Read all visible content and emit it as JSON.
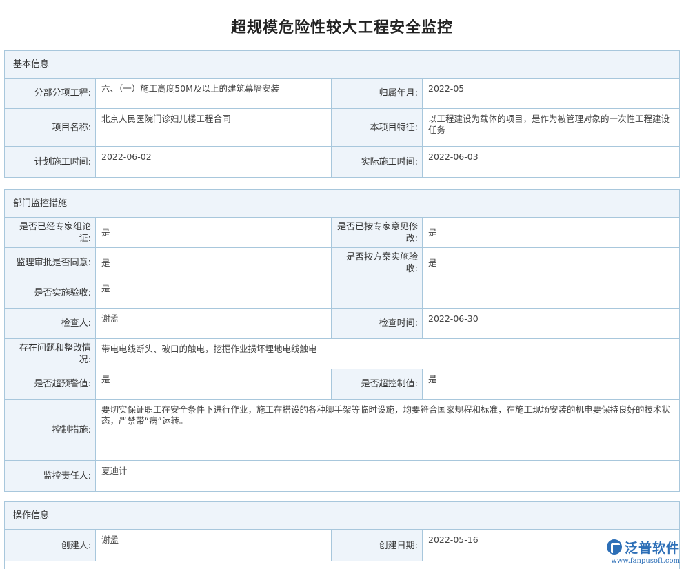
{
  "page": {
    "title": "超规模危险性较大工程安全监控"
  },
  "basic": {
    "header": "基本信息",
    "sub_project_label": "分部分项工程:",
    "sub_project_value": "六、（一）施工高度50M及以上的建筑幕墙安装",
    "month_label": "归属年月:",
    "month_value": "2022-05",
    "project_name_label": "项目名称:",
    "project_name_value": "北京人民医院门诊妇儿楼工程合同",
    "feature_label": "本项目特征:",
    "feature_value": "以工程建设为载体的项目，是作为被管理对象的一次性工程建设任务",
    "plan_date_label": "计划施工时间:",
    "plan_date_value": "2022-06-02",
    "actual_date_label": "实际施工时间:",
    "actual_date_value": "2022-06-03"
  },
  "monitor": {
    "header": "部门监控措施",
    "expert_label": "是否已经专家组论证:",
    "expert_value": "是",
    "revised_label": "是否已按专家意见修改:",
    "revised_value": "是",
    "supervision_label": "监理审批是否同意:",
    "supervision_value": "是",
    "plan_impl_label": "是否按方案实施验收:",
    "plan_impl_value": "是",
    "accept_label": "是否实施验收:",
    "accept_value": "是",
    "inspector_label": "检查人:",
    "inspector_value": "谢孟",
    "inspect_date_label": "检查时间:",
    "inspect_date_value": "2022-06-30",
    "issue_label": "存在问题和整改情况:",
    "issue_value": "带电电线断头、破口的触电，挖掘作业损坏埋地电线触电",
    "warning_label": "是否超预警值:",
    "warning_value": "是",
    "control_limit_label": "是否超控制值:",
    "control_limit_value": "是",
    "measures_label": "控制措施:",
    "measures_value": "要切实保证职工在安全条件下进行作业，施工在搭设的各种脚手架等临时设施，均要符合国家规程和标准，在施工现场安装的机电要保持良好的技术状态，严禁带“病”运转。",
    "responsible_label": "监控责任人:",
    "responsible_value": "夏迪计"
  },
  "operation": {
    "header": "操作信息",
    "creator_label": "创建人:",
    "creator_value": "谢孟",
    "created_date_label": "创建日期:",
    "created_date_value": "2022-05-16"
  },
  "logo": {
    "name": "泛普软件",
    "url": "www.fanpusoft.com"
  },
  "colors": {
    "border": "#a8c7dc",
    "label_bg": "#eef4fa",
    "brand": "#2d6fb7"
  }
}
